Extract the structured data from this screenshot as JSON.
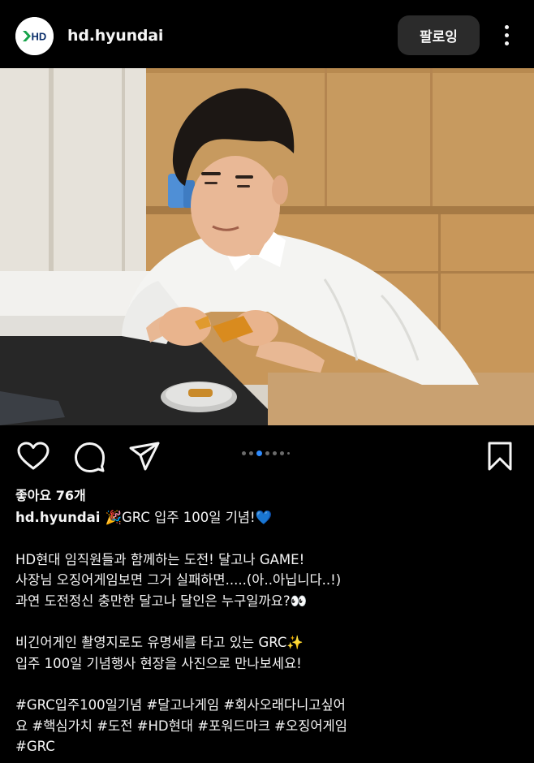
{
  "header": {
    "avatar_text": "HD",
    "username": "hd.hyundai",
    "follow_label": "팔로잉"
  },
  "carousel": {
    "slide_count": 7,
    "active_index": 2
  },
  "icons": {
    "like": "heart-icon",
    "comment": "comment-icon",
    "share": "send-icon",
    "save": "bookmark-icon"
  },
  "post": {
    "likes": "좋아요 76개",
    "username": "hd.hyundai",
    "caption_title": "🎉GRC 입주 100일 기념!💙",
    "paragraph1": [
      "HD현대 임직원들과 함께하는 도전! 달고나 GAME!",
      "사장님 오징어게임보면  그거 실패하면.....(아..아닙니다..!)",
      "과연 도전정신 충만한 달고나 달인은 누구일까요?👀"
    ],
    "paragraph2": [
      "비긴어게인 촬영지로도 유명세를 타고 있는 GRC✨",
      "입주 100일 기념행사 현장을 사진으로 만나보세요!"
    ],
    "hashtags": [
      "#GRC입주100일기념 #달고나게임 #회사오래다니고싶어",
      "요 #핵심가치 #도전 #HD현대 #포워드마크 #오징어게임",
      "#GRC"
    ]
  }
}
